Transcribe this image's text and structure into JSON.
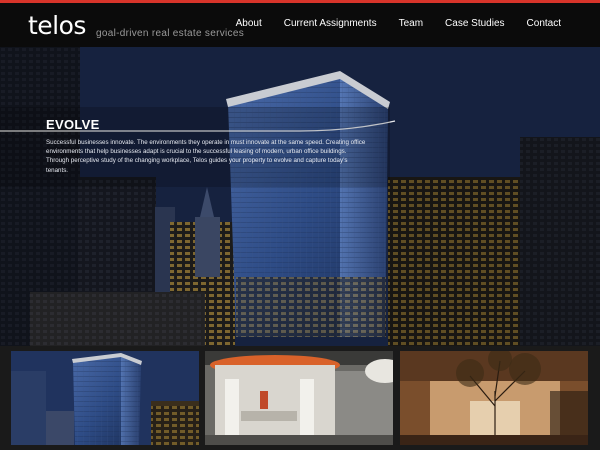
{
  "brand": {
    "logo_text": "telos",
    "tagline": "goal-driven real estate services",
    "accent_color": "#d8342a"
  },
  "nav": {
    "items": [
      {
        "label": "About"
      },
      {
        "label": "Current Assignments"
      },
      {
        "label": "Team"
      },
      {
        "label": "Case Studies"
      },
      {
        "label": "Contact"
      }
    ]
  },
  "hero": {
    "heading": "EVOLVE",
    "body": "Successful businesses innovate. The environments they operate in must innovate at the same speed. Creating office environments that help businesses adapt is crucial to the successful leasing of modern, urban office buildings. Through perceptive study of the changing workplace, Telos guides your property to evolve and capture today’s tenants."
  },
  "thumbnails": [
    {
      "name": "glass-tower-thumbnail"
    },
    {
      "name": "office-interior-thumbnail"
    },
    {
      "name": "lobby-tree-thumbnail"
    }
  ]
}
